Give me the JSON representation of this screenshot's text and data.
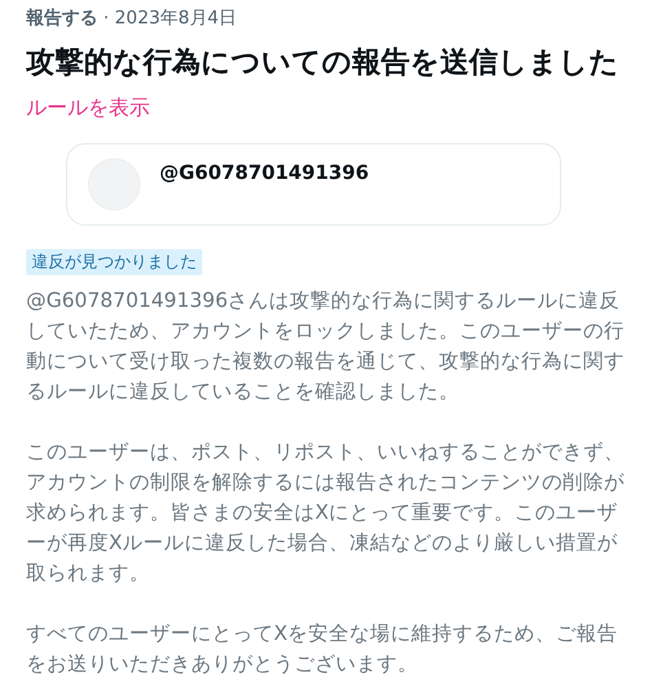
{
  "header": {
    "meta": "**報告する** · 2023年8月4日"
  },
  "title": "攻撃的な行為についての報告を送信しました",
  "rules_link": "ルールを表示",
  "account_card": {
    "handle": "@G6078701491396"
  },
  "status_badge": "違反が見つかりました",
  "paragraphs": [
    "@G6078701491396さんは攻撃的な行為に関するルールに違反していたため、アカウントをロックしました。このユーザーの行動について受け取った複数の報告を通じて、攻撃的な行為に関するルールに違反していることを確認しました。",
    "このユーザーは、ポスト、リポスト、いいねすることができず、アカウントの制限を解除するには報告されたコンテンツの削除が求められます。皆さまの安全はXにとって重要です。このユーザーが再度Xルールに違反した場合、凍結などのより厳しい措置が取られます。",
    "すべてのユーザーにとってXを安全な場に維持するため、ご報告をお送りいただきありがとうございます。"
  ]
}
